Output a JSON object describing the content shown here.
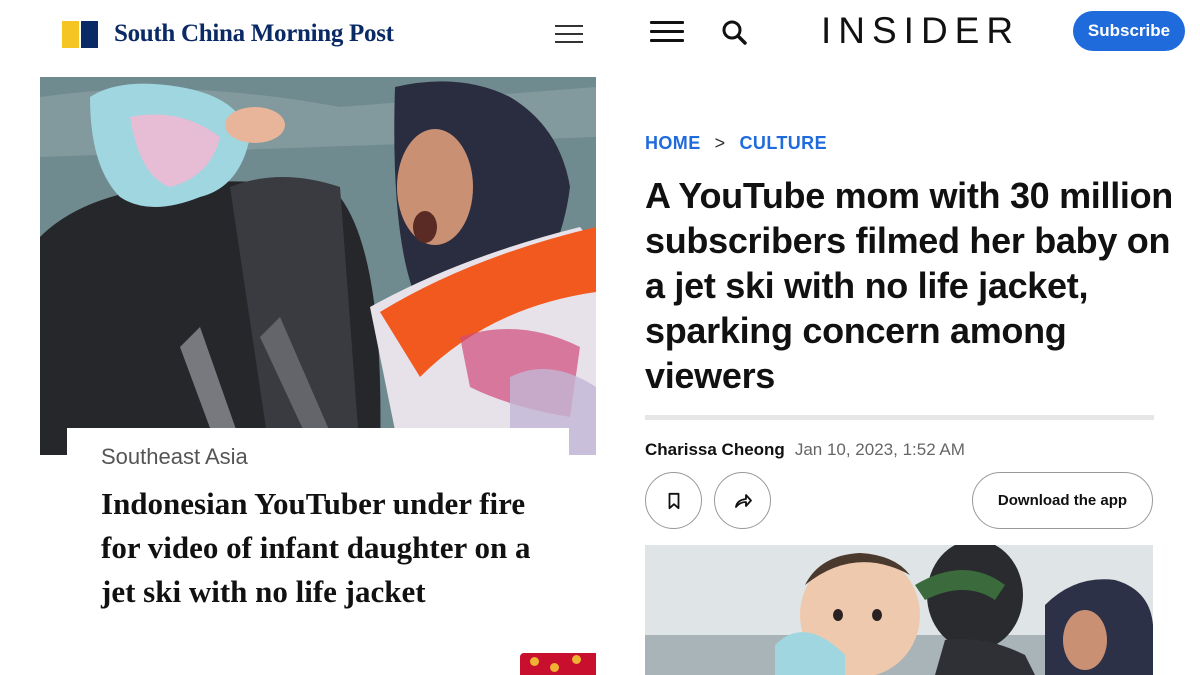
{
  "scmp": {
    "brand_name": "South China Morning Post",
    "section": "Southeast Asia",
    "headline": "Indonesian YouTuber under fire for video of infant daughter on a jet ski with no life jacket",
    "photo_icon": "news-photo",
    "colors": {
      "brand_navy": "#0a2a66",
      "brand_yellow": "#f5c623"
    }
  },
  "insider": {
    "brand_name": "INSIDER",
    "subscribe_label": "Subscribe",
    "breadcrumb": {
      "home": "HOME",
      "separator": ">",
      "section": "CULTURE"
    },
    "headline": "A YouTube mom with 30 million subscribers filmed her baby on a jet ski with no life jacket, sparking concern among viewers",
    "author": "Charissa Cheong",
    "date": "Jan 10, 2023, 1:52 AM",
    "download_label": "Download the app",
    "icons": {
      "menu": "hamburger-menu-icon",
      "search": "search-icon",
      "bookmark": "bookmark-icon",
      "share": "share-icon"
    },
    "colors": {
      "accent": "#1f6bdc"
    }
  }
}
